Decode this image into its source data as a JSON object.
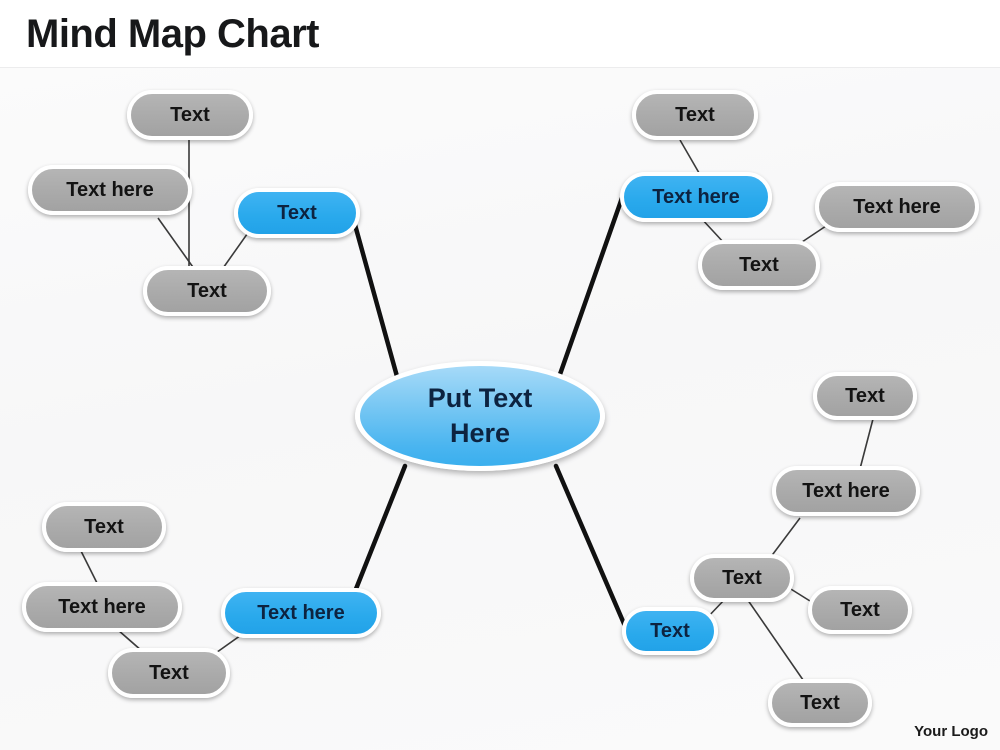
{
  "header": {
    "title": "Mind Map Chart"
  },
  "footer": {
    "logo_text": "Your Logo"
  },
  "center": {
    "line1": "Put Text",
    "line2": "Here"
  },
  "colors": {
    "blue_node": "#29a9ec",
    "gray_node": "#aaaaaa",
    "node_border": "#ffffff",
    "blue_text": "#0d2340",
    "gray_text": "#131313",
    "center_blue_top": "#a6daf8",
    "center_blue_bottom": "#3aafee",
    "trunk_line": "#111111",
    "branch_line": "#3a3a3a",
    "canvas_bg": "#f8f8f9",
    "title_text": "#17181a"
  },
  "branches": [
    {
      "id": "upper-left",
      "primary": {
        "label": "Text",
        "style": "blue"
      },
      "children": [
        {
          "label": "Text",
          "style": "gray"
        },
        {
          "label": "Text here",
          "style": "gray"
        },
        {
          "label": "Text",
          "style": "gray"
        }
      ]
    },
    {
      "id": "upper-right",
      "primary": {
        "label": "Text here",
        "style": "blue"
      },
      "children": [
        {
          "label": "Text",
          "style": "gray"
        },
        {
          "label": "Text",
          "style": "gray"
        },
        {
          "label": "Text here",
          "style": "gray"
        }
      ]
    },
    {
      "id": "lower-left",
      "primary": {
        "label": "Text here",
        "style": "blue"
      },
      "children": [
        {
          "label": "Text",
          "style": "gray"
        },
        {
          "label": "Text here",
          "style": "gray"
        },
        {
          "label": "Text",
          "style": "gray"
        }
      ]
    },
    {
      "id": "lower-right",
      "primary": {
        "label": "Text",
        "style": "blue"
      },
      "children": [
        {
          "label": "Text",
          "style": "gray"
        },
        {
          "label": "Text here",
          "style": "gray"
        },
        {
          "label": "Text",
          "style": "gray"
        },
        {
          "label": "Text",
          "style": "gray"
        },
        {
          "label": "Text",
          "style": "gray"
        }
      ]
    }
  ]
}
